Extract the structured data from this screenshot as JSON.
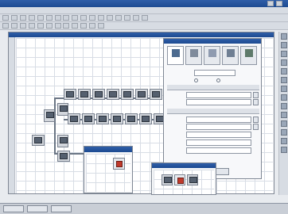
{
  "app": {
    "title": ""
  },
  "menu": {
    "items": [
      "",
      "",
      "",
      "",
      "",
      ""
    ]
  },
  "props": {
    "tabs": [
      "",
      "",
      "",
      "",
      ""
    ],
    "field_label_1": "",
    "field_value_1": "",
    "section_1": "",
    "section_2": "",
    "rows": [
      {
        "label": "",
        "value": ""
      },
      {
        "label": "",
        "value": ""
      },
      {
        "label": "",
        "value": ""
      },
      {
        "label": "",
        "value": ""
      },
      {
        "label": "",
        "value": ""
      },
      {
        "label": "",
        "value": ""
      },
      {
        "label": "",
        "value": ""
      }
    ],
    "buttons": [
      "",
      "",
      ""
    ]
  },
  "popup": {
    "title": ""
  },
  "taskbar": {
    "items": [
      "",
      "",
      ""
    ]
  },
  "colors": {
    "titlebar": "#2f5ea8",
    "accent_red": "#c0392b",
    "grid": "#d8dde5"
  }
}
